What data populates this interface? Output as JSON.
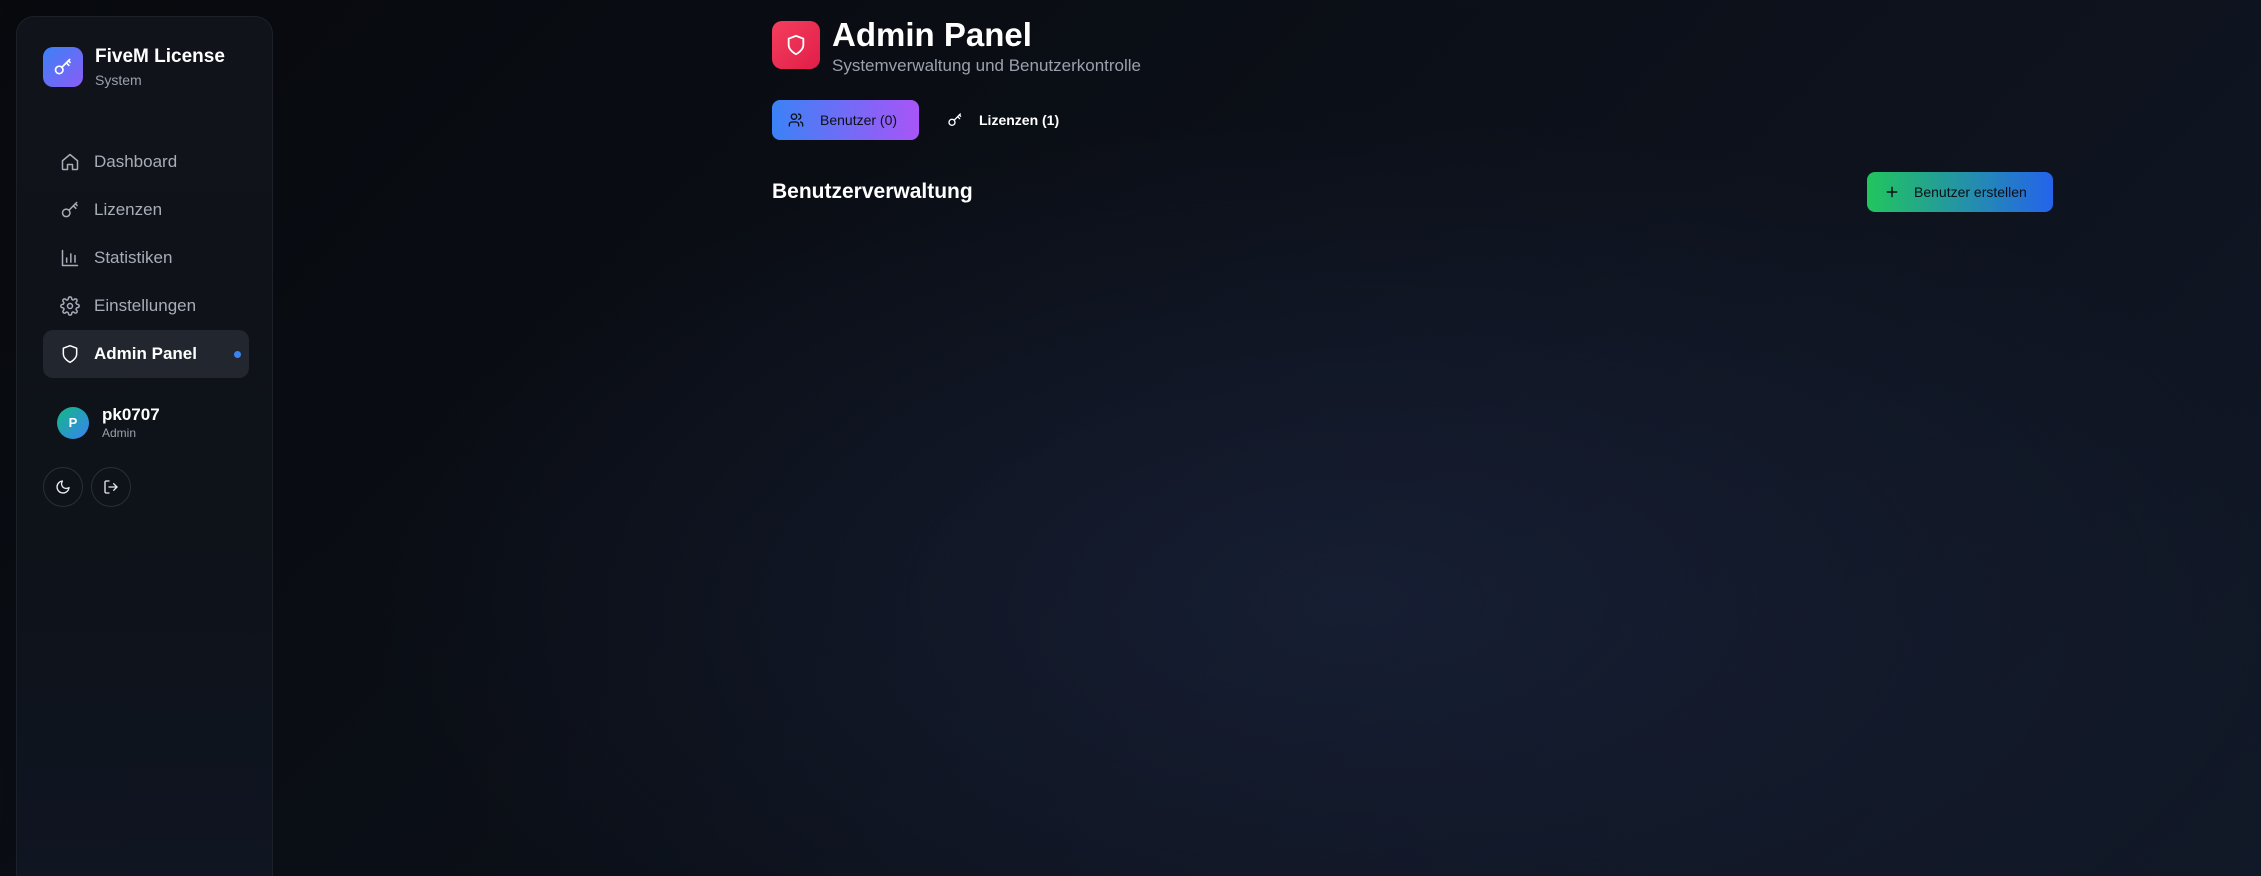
{
  "brand": {
    "title": "FiveM License",
    "subtitle": "System",
    "icon": "key-icon"
  },
  "sidebar": {
    "items": [
      {
        "label": "Dashboard",
        "icon": "home-icon"
      },
      {
        "label": "Lizenzen",
        "icon": "key-icon"
      },
      {
        "label": "Statistiken",
        "icon": "bar-chart-icon"
      },
      {
        "label": "Einstellungen",
        "icon": "gear-icon"
      },
      {
        "label": "Admin Panel",
        "icon": "shield-icon",
        "active": true
      }
    ]
  },
  "user": {
    "initial": "P",
    "name": "pk0707",
    "role": "Admin"
  },
  "header": {
    "title": "Admin Panel",
    "subtitle": "Systemverwaltung und Benutzerkontrolle",
    "icon": "shield-icon"
  },
  "tabs": [
    {
      "label": "Benutzer (0)",
      "icon": "users-icon",
      "active": true
    },
    {
      "label": "Lizenzen (1)",
      "icon": "key-icon",
      "active": false
    }
  ],
  "section": {
    "title": "Benutzerverwaltung",
    "create_button": "Benutzer erstellen"
  },
  "colors": {
    "accent_blue": "#3b82f6",
    "accent_purple": "#a855f7",
    "danger_badge": "#e11d48",
    "create_green": "#22c55e"
  }
}
